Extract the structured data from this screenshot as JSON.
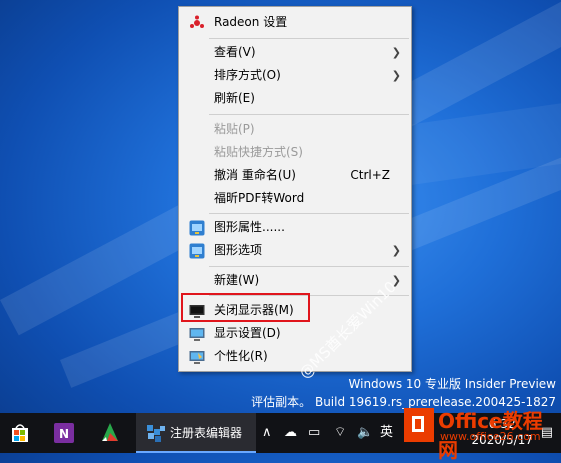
{
  "context_menu": {
    "items": [
      {
        "label": "Radeon 设置",
        "icon": "radeon-icon"
      },
      {
        "label": "查看(V)",
        "submenu": true
      },
      {
        "label": "排序方式(O)",
        "submenu": true
      },
      {
        "label": "刷新(E)"
      },
      {
        "label": "粘贴(P)",
        "disabled": true
      },
      {
        "label": "粘贴快捷方式(S)",
        "disabled": true
      },
      {
        "label": "撤消 重命名(U)",
        "shortcut": "Ctrl+Z"
      },
      {
        "label": "福昕PDF转Word"
      },
      {
        "label": "图形属性......",
        "icon": "graphics-icon"
      },
      {
        "label": "图形选项",
        "icon": "graphics-icon",
        "submenu": true
      },
      {
        "label": "新建(W)",
        "submenu": true
      },
      {
        "label": "关闭显示器(M)",
        "icon": "monitor-off-icon"
      },
      {
        "label": "显示设置(D)",
        "icon": "display-icon"
      },
      {
        "label": "个性化(R)",
        "icon": "personalize-icon"
      }
    ]
  },
  "watermark": {
    "text": "@MS酋长爱Win10"
  },
  "desktop": {
    "edition_line1": "Windows 10 专业版 Insider Preview",
    "edition_line2": "评估副本。 Build 19619.rs_prerelease.200425-1827"
  },
  "taskbar": {
    "active_app_label": "注册表编辑器",
    "ime": "英",
    "time": "6:32",
    "date": "2020/5/17"
  },
  "logo": {
    "title": "Office教程网",
    "url": "www.office26.com"
  },
  "colors": {
    "highlight": "#e0151c",
    "logo": "#eb3c00",
    "taskbar": "#111216"
  }
}
